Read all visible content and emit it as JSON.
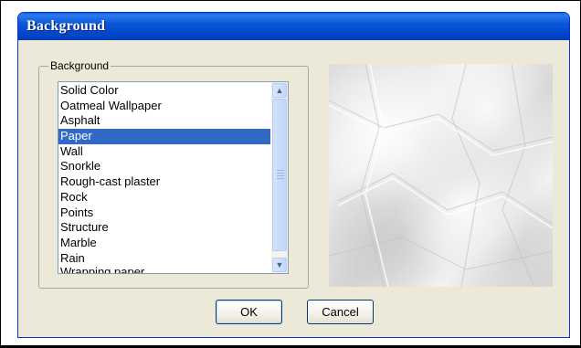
{
  "dialog": {
    "title": "Background",
    "group_label": "Background",
    "list": {
      "items": [
        "Solid Color",
        "Oatmeal Wallpaper",
        "Asphalt",
        "Paper",
        "Wall",
        "Snorkle",
        "Rough-cast plaster",
        "Rock",
        "Points",
        "Structure",
        "Marble",
        "Rain",
        "Wrapping paper"
      ],
      "selected": "Paper"
    },
    "preview": {
      "texture": "crumpled-paper"
    },
    "buttons": {
      "ok": "OK",
      "cancel": "Cancel"
    }
  },
  "colors": {
    "title_bar": "#0054e3",
    "dialog_bg": "#ece9d8",
    "selection": "#316ac5"
  }
}
